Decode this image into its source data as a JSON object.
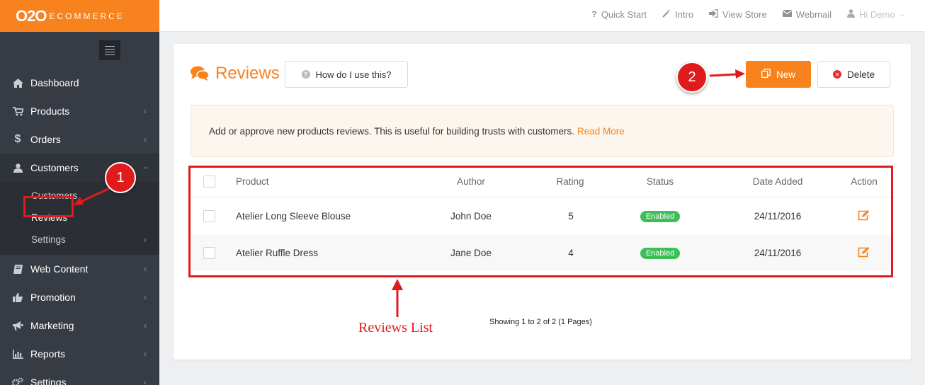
{
  "brand": {
    "logo_main": "O2O",
    "logo_sub": "ECOMMERCE"
  },
  "sidebar": {
    "items": [
      {
        "label": "Dashboard",
        "icon": "home-icon"
      },
      {
        "label": "Products",
        "icon": "cart-icon"
      },
      {
        "label": "Orders",
        "icon": "dollar-icon"
      },
      {
        "label": "Customers",
        "icon": "user-icon"
      },
      {
        "label": "Web Content",
        "icon": "book-icon"
      },
      {
        "label": "Promotion",
        "icon": "thumbs-up-icon"
      },
      {
        "label": "Marketing",
        "icon": "bullhorn-icon"
      },
      {
        "label": "Reports",
        "icon": "bar-chart-icon"
      },
      {
        "label": "Settings",
        "icon": "gears-icon"
      }
    ],
    "customers_sub": [
      {
        "label": "Customers"
      },
      {
        "label": "Reviews"
      },
      {
        "label": "Settings"
      }
    ]
  },
  "topbar": {
    "quick_start": "Quick Start",
    "intro": "Intro",
    "view_store": "View Store",
    "webmail": "Webmail",
    "user": "Hi Demo"
  },
  "page": {
    "title": "Reviews",
    "help_label": "How do I use this?",
    "new_label": "New",
    "delete_label": "Delete",
    "info_text": "Add or approve new products reviews. This is useful for building trusts with customers.",
    "read_more": "Read More"
  },
  "table": {
    "headers": {
      "product": "Product",
      "author": "Author",
      "rating": "Rating",
      "status": "Status",
      "date": "Date Added",
      "action": "Action"
    },
    "rows": [
      {
        "product": "Atelier Long Sleeve Blouse",
        "author": "John Doe",
        "rating": "5",
        "status": "Enabled",
        "date": "24/11/2016"
      },
      {
        "product": "Atelier Ruffle Dress",
        "author": "Jane Doe",
        "rating": "4",
        "status": "Enabled",
        "date": "24/11/2016"
      }
    ],
    "paging": "Showing 1 to 2 of 2 (1 Pages)"
  },
  "annotations": {
    "step1": "1",
    "step2": "2",
    "list_label": "Reviews List"
  },
  "colors": {
    "accent": "#f7821e",
    "sidebar": "#373c44",
    "annotation": "#e01b1b",
    "enabled": "#3dbf58"
  }
}
